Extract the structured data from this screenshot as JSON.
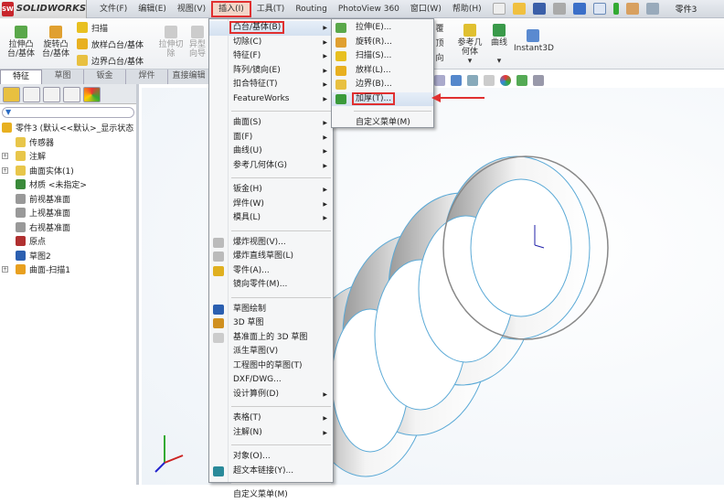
{
  "app": {
    "logo": "SOLIDWORKS",
    "title": "零件3"
  },
  "menubar": [
    "文件(F)",
    "编辑(E)",
    "视图(V)",
    "插入(I)",
    "工具(T)",
    "Routing",
    "PhotoView 360",
    "窗口(W)",
    "帮助(H)"
  ],
  "ribbon": {
    "extrude_boss": "拉伸凸\n台/基体",
    "revolve_boss": "旋转凸\n台/基体",
    "sweep": "扫描",
    "loft": "放样凸台/基体",
    "boundary": "边界凸台/基体",
    "extrude_cut": "拉伸切\n除",
    "hole": "异型\n向导",
    "partial": [
      "覆",
      "顶",
      "向"
    ],
    "ref_geometry": "参考几\n何体",
    "curves": "曲线",
    "instant3d": "Instant3D"
  },
  "tabs": [
    "特征",
    "草图",
    "钣金",
    "焊件",
    "直接编辑"
  ],
  "tree": {
    "filter": "▼",
    "root": "零件3 (默认<<默认>_显示状态",
    "items": [
      {
        "label": "传感器",
        "exp": false,
        "color": "#e8c64a"
      },
      {
        "label": "注解",
        "exp": true,
        "color": "#e8c64a"
      },
      {
        "label": "曲面实体(1)",
        "exp": true,
        "color": "#e8c64a"
      },
      {
        "label": "材质 <未指定>",
        "exp": false,
        "color": "#3a8a3a"
      },
      {
        "label": "前视基准面",
        "exp": false,
        "color": "#999"
      },
      {
        "label": "上视基准面",
        "exp": false,
        "color": "#999"
      },
      {
        "label": "右视基准面",
        "exp": false,
        "color": "#999"
      },
      {
        "label": "原点",
        "exp": false,
        "color": "#b03030"
      },
      {
        "label": "草图2",
        "exp": false,
        "color": "#2b5fb0"
      },
      {
        "label": "曲面-扫描1",
        "exp": true,
        "color": "#e8a020"
      }
    ]
  },
  "insert_menu": [
    {
      "label": "凸台/基体(B)",
      "sub": true,
      "hl": true
    },
    {
      "label": "切除(C)",
      "sub": true
    },
    {
      "label": "特征(F)",
      "sub": true
    },
    {
      "label": "阵列/镜向(E)",
      "sub": true
    },
    {
      "label": "扣合特征(T)",
      "sub": true
    },
    {
      "label": "FeatureWorks",
      "sub": true
    },
    {
      "sep": true
    },
    {
      "label": "曲面(S)",
      "sub": true
    },
    {
      "label": "面(F)",
      "sub": true
    },
    {
      "label": "曲线(U)",
      "sub": true
    },
    {
      "label": "参考几何体(G)",
      "sub": true
    },
    {
      "sep": true
    },
    {
      "label": "钣金(H)",
      "sub": true
    },
    {
      "label": "焊件(W)",
      "sub": true
    },
    {
      "label": "模具(L)",
      "sub": true
    },
    {
      "sep": true
    },
    {
      "label": "爆炸视图(V)...",
      "dim": true,
      "icon": "#bbb"
    },
    {
      "label": "爆炸直线草图(L)",
      "dim": true,
      "icon": "#bbb"
    },
    {
      "label": "零件(A)...",
      "icon": "#e0b020"
    },
    {
      "label": "镜向零件(M)...",
      "dim": true
    },
    {
      "sep": true
    },
    {
      "label": "草图绘制",
      "icon": "#2b5fb0"
    },
    {
      "label": "3D 草图",
      "icon": "#d09020"
    },
    {
      "label": "基准面上的 3D 草图",
      "dim": true,
      "icon": "#ccc"
    },
    {
      "label": "派生草图(V)",
      "dim": true
    },
    {
      "label": "工程图中的草图(T)",
      "dim": true
    },
    {
      "label": "DXF/DWG..."
    },
    {
      "label": "设计算例(D)",
      "sub": true
    },
    {
      "sep": true
    },
    {
      "label": "表格(T)",
      "sub": true
    },
    {
      "label": "注解(N)",
      "sub": true
    },
    {
      "sep": true
    },
    {
      "label": "对象(O)..."
    },
    {
      "label": "超文本链接(Y)...",
      "icon": "#2a8a9a"
    },
    {
      "sep": true
    },
    {
      "label": "自定义菜单(M)"
    }
  ],
  "submenu": [
    {
      "label": "拉伸(E)...",
      "icon": "#5aa84a"
    },
    {
      "label": "旋转(R)...",
      "icon": "#e0a030"
    },
    {
      "label": "扫描(S)...",
      "icon": "#e8c020"
    },
    {
      "label": "放样(L)...",
      "icon": "#e8b020"
    },
    {
      "label": "边界(B)...",
      "icon": "#e8c040"
    },
    {
      "label": "加厚(T)...",
      "icon": "#3a9a3a",
      "hl": true
    },
    {
      "sep": true
    },
    {
      "label": "自定义菜单(M)"
    }
  ],
  "colors": {
    "highlight": "#e03030",
    "spring_edge": "#5aa9d6"
  }
}
